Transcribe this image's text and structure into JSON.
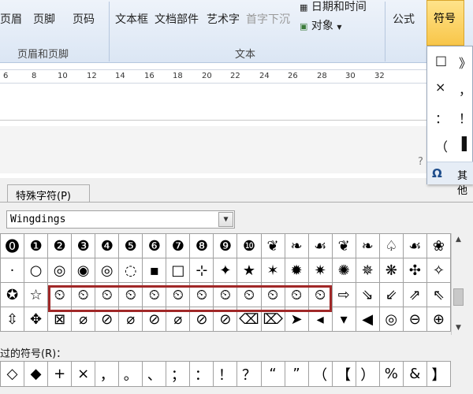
{
  "ribbon": {
    "items": [
      "页眉",
      "页脚",
      "页码",
      "文本框",
      "文档部件",
      "艺术字",
      "首字下沉",
      "日期和时间",
      "对象",
      "公式",
      "符号"
    ],
    "group_header_footer": "页眉和页脚",
    "group_text": "文本"
  },
  "ruler": [
    "6",
    "8",
    "10",
    "12",
    "14",
    "16",
    "18",
    "20",
    "22",
    "24",
    "26",
    "28",
    "30",
    "32"
  ],
  "doc": {
    "qmark": "?"
  },
  "popup": {
    "chars": [
      "□",
      "》",
      "×",
      "，",
      "：",
      "！",
      "（",
      "▌"
    ],
    "omega": "Ω",
    "other_label": "其他"
  },
  "dialog": {
    "tab_label": "特殊字符(P)",
    "font_value": "Wingdings",
    "recent_label": "近期使用过的符号(R)：",
    "recent_label_visible": "过的符号(R)：",
    "grid": [
      [
        "⓿",
        "❶",
        "❷",
        "❸",
        "❹",
        "❺",
        "❻",
        "❼",
        "❽",
        "❾",
        "❿",
        "❦",
        "❧",
        "☙",
        "❦",
        "❧",
        "♤",
        "☙",
        "❀"
      ],
      [
        "·",
        "○",
        "◎",
        "◉",
        "◎",
        "◌",
        "▪",
        "□",
        "⊹",
        "✦",
        "★",
        "✶",
        "✹",
        "✷",
        "✺",
        "✵",
        "❋",
        "✣",
        "✧"
      ],
      [
        "✪",
        "☆",
        "⏲",
        "⏲",
        "⏲",
        "⏲",
        "⏲",
        "⏲",
        "⏲",
        "⏲",
        "⏲",
        "⏲",
        "⏲",
        "⏲",
        "⇨",
        "⇘",
        "⇙",
        "⇗",
        "⇖"
      ],
      [
        "⇳",
        "✥",
        "⊠",
        "⌀",
        "⊘",
        "⌀",
        "⊘",
        "⌀",
        "⊘",
        "⊘",
        "⌫",
        "⌦",
        "➤",
        "◂",
        "▾",
        "◀",
        "◎",
        "⊖",
        "⊕"
      ]
    ],
    "recent": [
      "◇",
      "◆",
      "+",
      "×",
      "，",
      "。",
      "、",
      "；",
      "：",
      "！",
      "？",
      "“",
      "”",
      "（",
      "【",
      "）",
      "%",
      "&",
      "】"
    ]
  }
}
